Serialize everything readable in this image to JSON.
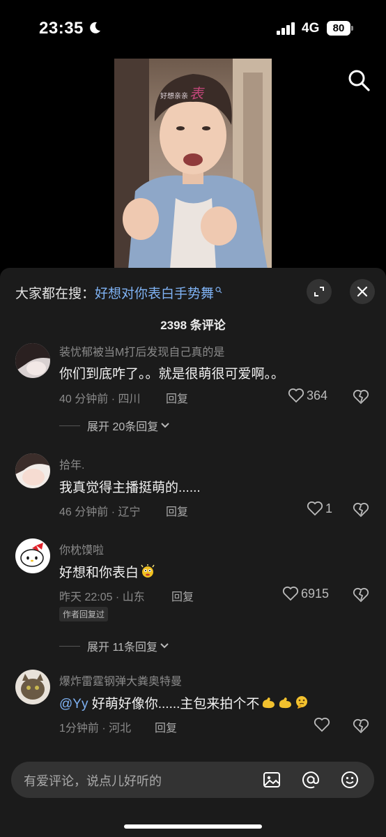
{
  "status": {
    "time": "23:35",
    "network": "4G",
    "battery": "80"
  },
  "video": {
    "overlay_small": "好想亲亲",
    "overlay_large": "表"
  },
  "sheet": {
    "search_prefix": "大家都在搜：",
    "search_keyword": "好想对你表白手势舞",
    "comment_count": "2398 条评论"
  },
  "comments": [
    {
      "username": "装忧郁被当M打后发现自己真的是",
      "text": "你们到底咋了。。就是很萌很可爱啊。。",
      "meta": "40 分钟前 · 四川",
      "reply": "回复",
      "likes": "364",
      "expand": "展开 20条回复"
    },
    {
      "username": "拾年.",
      "text": "我真觉得主播挺萌的......",
      "meta": "46 分钟前 · 辽宁",
      "reply": "回复",
      "likes": "1"
    },
    {
      "username": "你枕馍啦",
      "text": "好想和你表白",
      "meta": "昨天 22:05 · 山东",
      "reply": "回复",
      "likes": "6915",
      "badge": "作者回复过",
      "expand": "展开 11条回复"
    },
    {
      "username": "爆炸雷霆钢弹大粪奥特曼",
      "mention": "@Yy",
      "text": " 好萌好像你......主包来拍个不",
      "meta": "1分钟前 · 河北",
      "reply": "回复"
    }
  ],
  "input": {
    "placeholder": "有爱评论，说点儿好听的"
  },
  "icons": [
    "moon-icon",
    "signal-icon",
    "battery-icon",
    "search-icon",
    "expand-icon",
    "close-icon",
    "heart-icon",
    "heart-broken-icon",
    "chevron-down-icon",
    "image-icon",
    "at-icon",
    "emoji-icon"
  ]
}
